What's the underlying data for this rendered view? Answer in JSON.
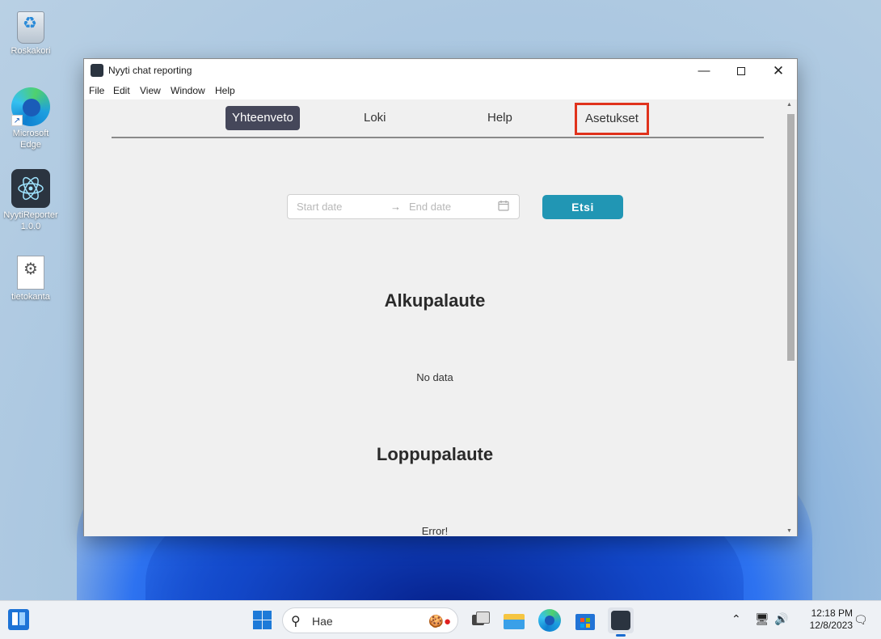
{
  "desktop": {
    "icons": [
      {
        "label": "Roskakori"
      },
      {
        "label": "Microsoft Edge"
      },
      {
        "label": "NyytiReporter 1.0.0"
      },
      {
        "label": "tietokanta"
      }
    ]
  },
  "window": {
    "title": "Nyyti chat reporting",
    "controls": {
      "minimize": "—",
      "close": "✕"
    },
    "menu": [
      "File",
      "Edit",
      "View",
      "Window",
      "Help"
    ]
  },
  "tabs": [
    {
      "label": "Yhteenveto",
      "active": true
    },
    {
      "label": "Loki",
      "active": false
    },
    {
      "label": "Help",
      "active": false
    },
    {
      "label": "Asetukset",
      "active": false,
      "highlighted": true
    }
  ],
  "filter": {
    "start_placeholder": "Start date",
    "end_placeholder": "End date",
    "separator": "→",
    "search_label": "Etsi"
  },
  "sections": [
    {
      "title": "Alkupalaute",
      "message": "No data"
    },
    {
      "title": "Loppupalaute",
      "message": "Error!"
    }
  ],
  "taskbar": {
    "search_placeholder": "Hae",
    "time": "12:18 PM",
    "date": "12/8/2023"
  },
  "colors": {
    "active_tab": "#45475a",
    "search_button": "#2196b4",
    "highlight_box": "#e0321c"
  }
}
